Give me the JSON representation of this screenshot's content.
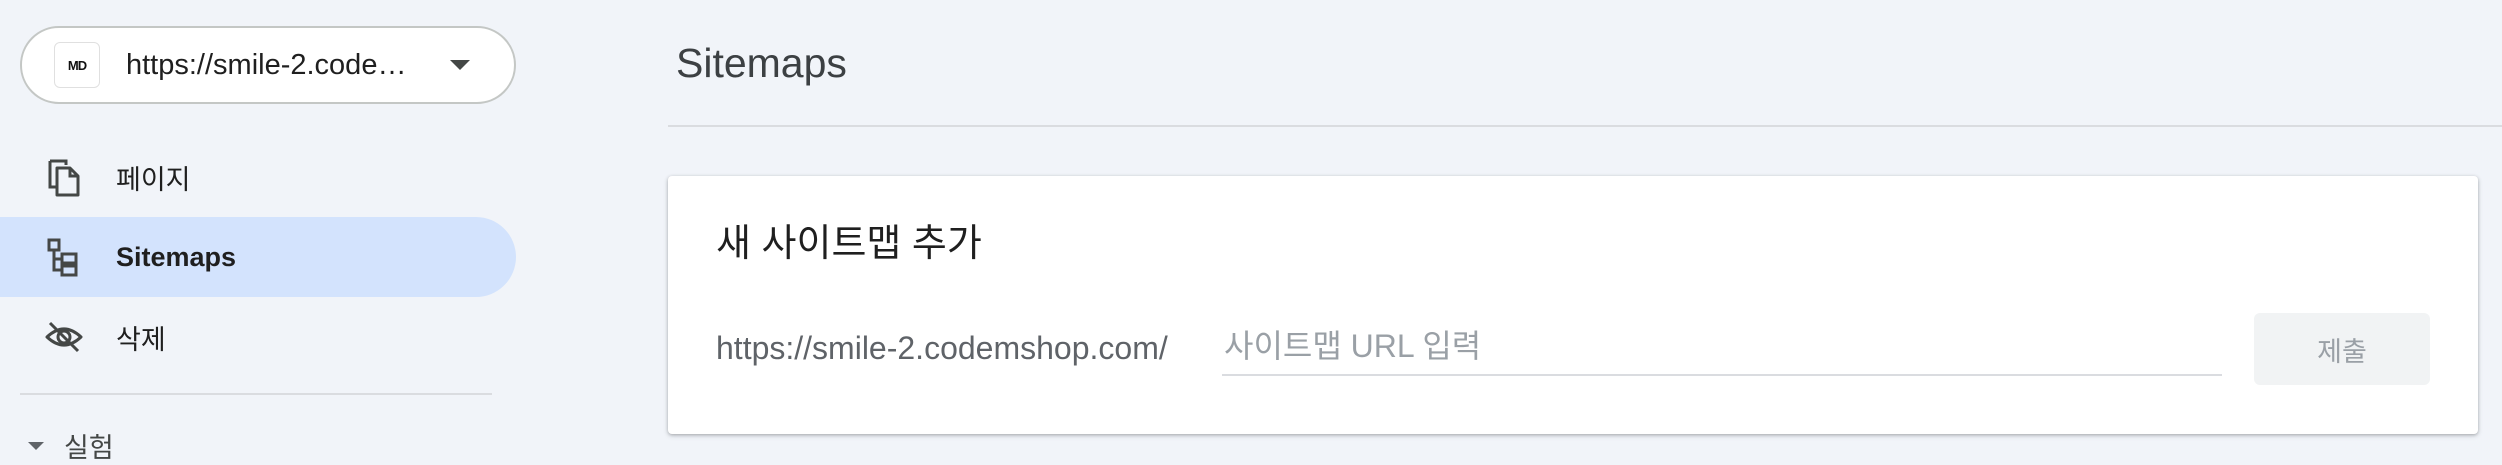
{
  "property": {
    "favicon_text": "MD",
    "url": "https://smile-2.codemshop.com/"
  },
  "nav": {
    "items": [
      {
        "label": "페이지",
        "icon": "pages-icon",
        "active": false
      },
      {
        "label": "Sitemaps",
        "icon": "sitemap-icon",
        "active": true
      },
      {
        "label": "삭제",
        "icon": "visibility-off-icon",
        "active": false
      }
    ],
    "section_label": "실험"
  },
  "main": {
    "page_title": "Sitemaps",
    "card": {
      "title": "새 사이트맵 추가",
      "url_prefix": "https://smile-2.codemshop.com/",
      "input_value": "",
      "input_placeholder": "사이트맵 URL 입력",
      "submit_label": "제출"
    }
  },
  "colors": {
    "background": "#f1f4f9",
    "active_nav": "#d3e3fd",
    "card": "#ffffff",
    "disabled_button": "#f1f3f4",
    "disabled_text": "#9aa0a6"
  }
}
